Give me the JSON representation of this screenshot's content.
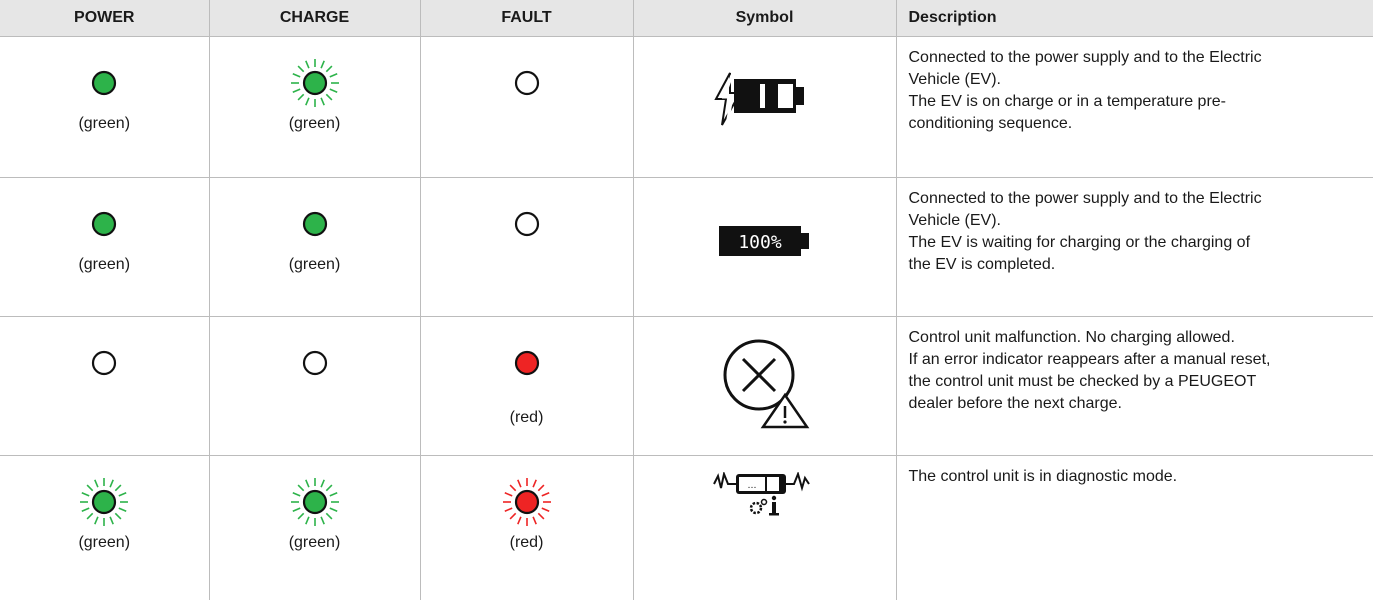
{
  "headers": {
    "power": "POWER",
    "charge": "CHARGE",
    "fault": "FAULT",
    "symbol": "Symbol",
    "description": "Description"
  },
  "colors": {
    "green": "#2db34a",
    "red": "#ee2424",
    "header_bg": "#e6e6e6",
    "border": "#bcbcbc"
  },
  "rows": [
    {
      "power": {
        "state": "on",
        "color": "green",
        "label": "(green)"
      },
      "charge": {
        "state": "flashing",
        "color": "green",
        "label": "(green)"
      },
      "fault": {
        "state": "off",
        "label": ""
      },
      "symbol_icon": "battery-charging-icon",
      "description": [
        "Connected to the power supply and to the Electric",
        "Vehicle (EV).",
        "The EV is on charge or in a temperature pre-",
        "conditioning sequence."
      ]
    },
    {
      "power": {
        "state": "on",
        "color": "green",
        "label": "(green)"
      },
      "charge": {
        "state": "on",
        "color": "green",
        "label": "(green)"
      },
      "fault": {
        "state": "off",
        "label": ""
      },
      "symbol_icon": "battery-full-icon",
      "symbol_text": "100%",
      "description": [
        "Connected to the power supply and to the Electric",
        "Vehicle (EV).",
        "The EV is waiting for charging or the charging of",
        "the EV is completed."
      ]
    },
    {
      "power": {
        "state": "off",
        "label": ""
      },
      "charge": {
        "state": "off",
        "label": ""
      },
      "fault": {
        "state": "on",
        "color": "red",
        "label": "(red)"
      },
      "symbol_icon": "error-warning-icon",
      "description": [
        "Control unit malfunction. No charging allowed.",
        "If an error indicator reappears after a manual reset,",
        "the control unit must be checked by a PEUGEOT",
        "dealer before the next charge."
      ]
    },
    {
      "power": {
        "state": "flashing",
        "color": "green",
        "label": "(green)"
      },
      "charge": {
        "state": "flashing",
        "color": "green",
        "label": "(green)"
      },
      "fault": {
        "state": "flashing",
        "color": "red",
        "label": "(red)"
      },
      "symbol_icon": "diagnostic-mode-icon",
      "description": [
        "The control unit is in diagnostic mode."
      ]
    }
  ]
}
